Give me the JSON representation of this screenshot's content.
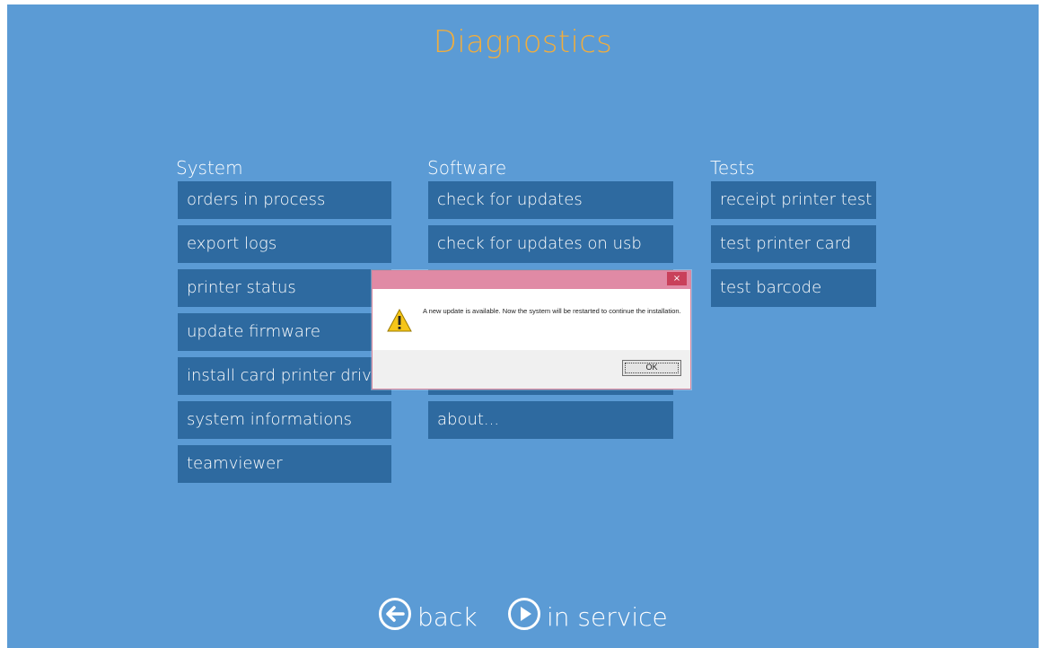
{
  "header": {
    "title": "Diagnostics"
  },
  "columns": {
    "system": {
      "heading": "System",
      "items": [
        "orders in process",
        "export logs",
        "printer status",
        "update firmware",
        "install card printer drive",
        "system informations",
        "teamviewer"
      ]
    },
    "software": {
      "heading": "Software",
      "items": [
        "check for updates",
        "check for updates on usb",
        "",
        "",
        "",
        "about..."
      ]
    },
    "tests": {
      "heading": "Tests",
      "items": [
        "receipt printer test",
        "test printer card",
        "test barcode"
      ]
    }
  },
  "dialog": {
    "close_glyph": "×",
    "message": "A new update is available. Now the system will be restarted to continue the installation.",
    "ok_label": "OK",
    "icon": "warning-icon"
  },
  "footer": {
    "back_label": "back",
    "in_service_label": "in service",
    "back_icon": "arrow-left-circle-icon",
    "in_service_icon": "play-circle-icon"
  },
  "colors": {
    "background": "#5b9bd5",
    "tile": "#2e6aa0",
    "title": "#f0ad3e",
    "dialog_titlebar": "#e08aa5"
  }
}
